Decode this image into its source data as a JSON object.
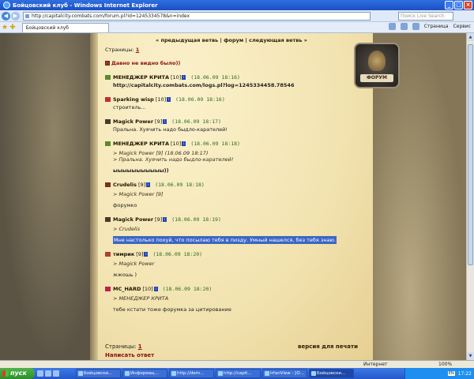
{
  "window": {
    "title": "Бойцовский клуб - Windows Internet Explorer"
  },
  "addressbar": {
    "url": "http://capitalcity.combats.com/forum.pl?id=1245334578&n=index",
    "search_placeholder": "Поиск Live Search"
  },
  "tab": {
    "label": "Бойцовский клуб"
  },
  "commandbar": {
    "page_label": "Страница",
    "tools_label": "Сервис"
  },
  "forum": {
    "nav_prev": "« предыдущая ветвь",
    "nav_forum": "форум",
    "nav_next": "следующая ветвь »",
    "sep": "|",
    "pages_label": "Страницы:",
    "page_num": "1",
    "topic_title": "Давно не видно было))",
    "emblem_label": "ФОРУМ",
    "print_label": "версия для печати",
    "reply_label": "Написать ответ"
  },
  "posts": [
    {
      "nick": "МЕНЕДЖЕР КРИТА",
      "level": "[10]",
      "date": "(18.06.09 18:16)",
      "text": "http://capitalcity.combats.com/logs.pl?log=1245334458.78546",
      "clan_color": "#5a8a30"
    },
    {
      "nick": "Sparking wisp",
      "level": "[10]",
      "date": "(18.06.09 18:16)",
      "text": "строитель...",
      "clan_color": "#c03030"
    },
    {
      "nick": "Magick Power",
      "level": "[9]",
      "date": "(18.06.09 18:17)",
      "text": "Пральна. Хуячить надо быдло-карателей!",
      "clan_color": "#4a3a2a"
    },
    {
      "nick": "МЕНЕДЖЕР КРИТА",
      "level": "[10]",
      "date": "(18.06.09 18:18)",
      "quote1": "> Magick Power  [9]      (18.06.09 18:17)",
      "quote2": "> Пральна. Хуячить надо быдло-карателей!",
      "text": "ыыыыыыыыыыы))",
      "clan_color": "#5a8a30"
    },
    {
      "nick": "Crudelis",
      "level": "[9]",
      "date": "(18.06.09 18:18)",
      "quote1": "> Magick Power [9]",
      "text": "форумко",
      "clan_color": "#7a3020"
    },
    {
      "nick": "Magick Power",
      "level": "[9]",
      "date": "(18.06.09 18:19)",
      "quote1": "> Crudelis",
      "text": "Мне настолько похуй, что посылаю тебя в пизду. Умный нашелся, без тебя знаю.",
      "clan_color": "#4a3a2a"
    },
    {
      "nick": "тимрик",
      "level": "[9]",
      "date": "(18.06.09 18:20)",
      "quote1": "> Magick Power",
      "text": "жжошь )",
      "clan_color": "#b04030"
    },
    {
      "nick": "MC_HARD",
      "level": "[10]",
      "date": "(18.06.09 18:20)",
      "quote1": "> МЕНЕДЖЕР КРИТА",
      "text": "тебе кстати тоже форумка за цитирование",
      "clan_color": "#c02050"
    }
  ],
  "statusbar": {
    "zone": "Интернет",
    "zoom": "100%"
  },
  "taskbar": {
    "start": "пуск",
    "tasks": [
      "Бойцовски...",
      "Информац...",
      "http://dem...",
      "http://capit...",
      "IrfanView - [О...",
      "Бойцовски...",
      "Безымянны..."
    ],
    "lang": "EN",
    "clock": "17:22"
  }
}
